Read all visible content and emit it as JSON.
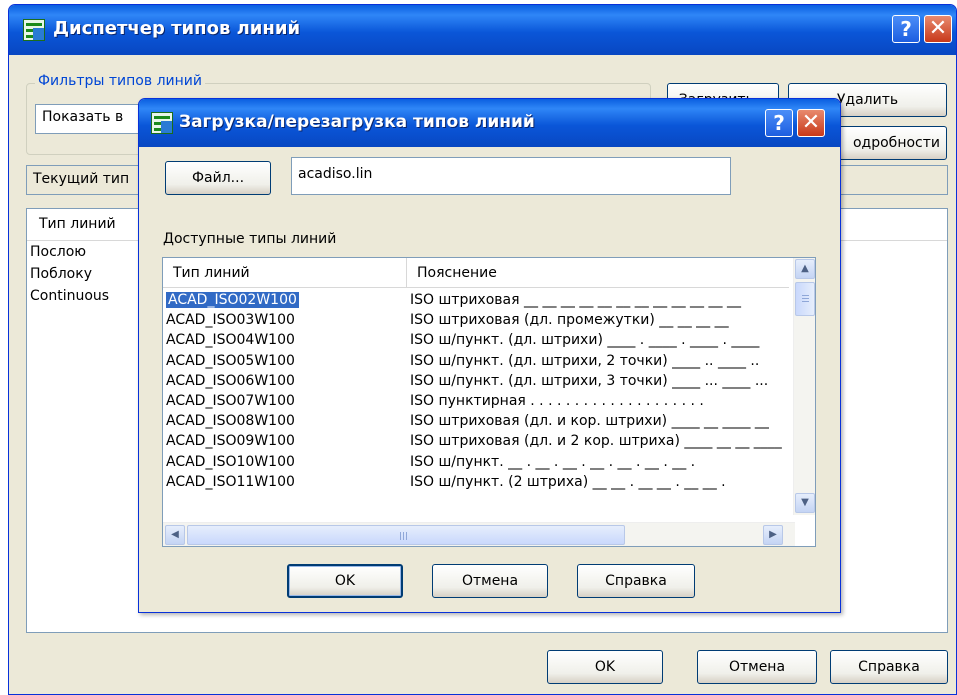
{
  "outer_dialog": {
    "title": "Диспетчер типов линий",
    "help_button": "?",
    "close_button": "✕",
    "filter_group_label": "Фильтры типов линий",
    "filter_value": "Показать в",
    "load_button": "Загрузить...",
    "delete_button": "Удалить",
    "details_button": "одробности",
    "current_type_label": "Текущий тип",
    "list_header": "Тип линий",
    "items": [
      "Послою",
      "Поблоку",
      "Continuous"
    ],
    "ok_button": "OK",
    "cancel_button": "Отмена",
    "help_bottom_button": "Справка"
  },
  "inner_dialog": {
    "title": "Загрузка/перезагрузка типов линий",
    "help_button": "?",
    "close_button": "✕",
    "file_button": "Файл...",
    "file_value": "acadiso.lin",
    "available_label": "Доступные типы линий",
    "columns": [
      "Тип линий",
      "Пояснение"
    ],
    "rows": [
      {
        "name": "ACAD_ISO02W100",
        "desc": "ISO штриховая __ __ __ __ __ __ __ __ __ __ __ __",
        "selected": true
      },
      {
        "name": "ACAD_ISO03W100",
        "desc": "ISO штриховая (дл. промежутки) __    __    __    __"
      },
      {
        "name": "ACAD_ISO04W100",
        "desc": "ISO ш/пункт. (дл. штрихи) ____ . ____ . ____ . ____"
      },
      {
        "name": "ACAD_ISO05W100",
        "desc": "ISO ш/пункт. (дл. штрихи, 2 точки) ____ .. ____ .."
      },
      {
        "name": "ACAD_ISO06W100",
        "desc": "ISO ш/пункт. (дл. штрихи, 3 точки) ____ ... ____ ..."
      },
      {
        "name": "ACAD_ISO07W100",
        "desc": "ISO пунктирная . . . . . . . . . . . . . . . . . . . ."
      },
      {
        "name": "ACAD_ISO08W100",
        "desc": "ISO штриховая (дл. и кор. штрихи) ____ __ ____ __"
      },
      {
        "name": "ACAD_ISO09W100",
        "desc": "ISO штриховая (дл. и 2 кор. штриха) ____ __ __ ____"
      },
      {
        "name": "ACAD_ISO10W100",
        "desc": "ISO ш/пункт. __ . __ . __ . __ . __ . __ . __ ."
      },
      {
        "name": "ACAD_ISO11W100",
        "desc": "ISO ш/пункт. (2 штриха)  __ __ .  __ __ .  __ __ ."
      }
    ],
    "scroll_up": "▲",
    "scroll_down": "▼",
    "scroll_left": "◀",
    "scroll_right": "▶",
    "ok_button": "OK",
    "cancel_button": "Отмена",
    "help_bottom_button": "Справка"
  },
  "colors": {
    "titlebar": "#0a56d8",
    "dialog_bg": "#ece9d8",
    "selection": "#316ac5",
    "group_label": "#0046d5"
  }
}
